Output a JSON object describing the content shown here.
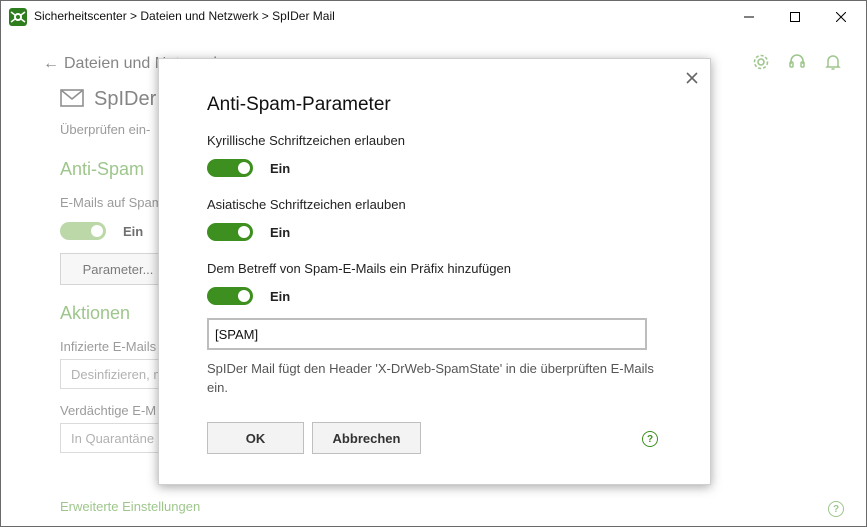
{
  "window": {
    "title": "Sicherheitscenter > Dateien und Netzwerk > SpIDer Mail"
  },
  "page": {
    "back_label": "Dateien und Netzwerk",
    "title": "SpIDer Mail",
    "subtitle": "Überprüfen ein-",
    "antispam": {
      "heading": "Anti-Spam",
      "label": "E-Mails auf Spam",
      "toggle_state": "Ein",
      "params_button": "Parameter..."
    },
    "actions": {
      "heading": "Aktionen",
      "infected_label": "Infizierte E-Mails",
      "infected_value": "Desinfizieren, n",
      "suspicious_label": "Verdächtige E-M",
      "suspicious_value": "In Quarantäne"
    },
    "advanced_link": "Erweiterte Einstellungen"
  },
  "dialog": {
    "title": "Anti-Spam-Parameter",
    "options": [
      {
        "label": "Kyrillische Schriftzeichen erlauben",
        "state": "Ein"
      },
      {
        "label": "Asiatische Schriftzeichen erlauben",
        "state": "Ein"
      },
      {
        "label": "Dem Betreff von Spam-E-Mails ein Präfix hinzufügen",
        "state": "Ein"
      }
    ],
    "prefix_value": "[SPAM]",
    "note": "SpIDer Mail fügt den Header 'X-DrWeb-SpamState' in die überprüften E-Mails ein.",
    "ok_label": "OK",
    "cancel_label": "Abbrechen",
    "help_glyph": "?"
  },
  "colors": {
    "accent": "#3d8f1f",
    "accent_light": "#6aa84f"
  }
}
